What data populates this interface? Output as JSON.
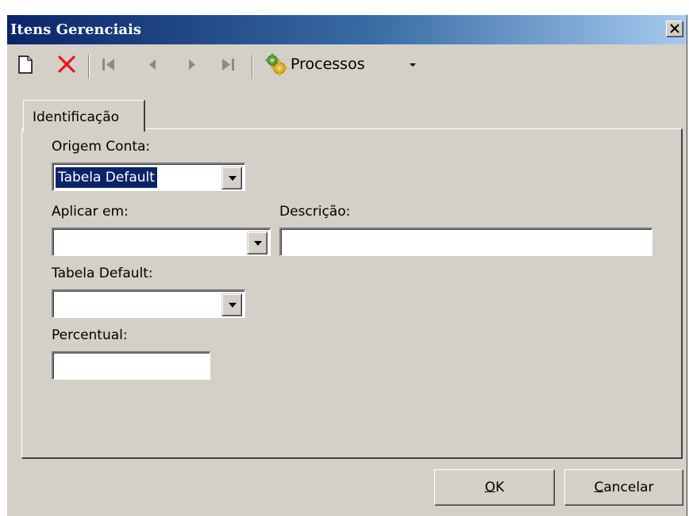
{
  "window": {
    "title": "Itens Gerenciais"
  },
  "toolbar": {
    "icons": [
      "new-document-icon",
      "delete-icon",
      "first-record-icon",
      "previous-record-icon",
      "next-record-icon",
      "last-record-icon",
      "processos-gears-icon",
      "dropdown-arrow-icon"
    ],
    "processos_label": "Processos"
  },
  "tabs": [
    {
      "label": "Identificação",
      "active": true
    }
  ],
  "form": {
    "origem_conta": {
      "label": "Origem Conta:",
      "value": "Tabela Default"
    },
    "aplicar_em": {
      "label": "Aplicar em:",
      "value": ""
    },
    "descricao": {
      "label": "Descrição:",
      "value": ""
    },
    "tabela_default": {
      "label": "Tabela Default:",
      "value": ""
    },
    "percentual": {
      "label": "Percentual:",
      "value": ""
    }
  },
  "buttons": {
    "ok_mnemonic": "O",
    "ok_rest": "K",
    "cancel_mnemonic": "C",
    "cancel_rest": "ancelar"
  },
  "colors": {
    "title_start": "#0a246a",
    "title_end": "#a6caf0",
    "face": "#d4d0c8",
    "selection": "#0a246a",
    "delete_red": "#e81818"
  }
}
